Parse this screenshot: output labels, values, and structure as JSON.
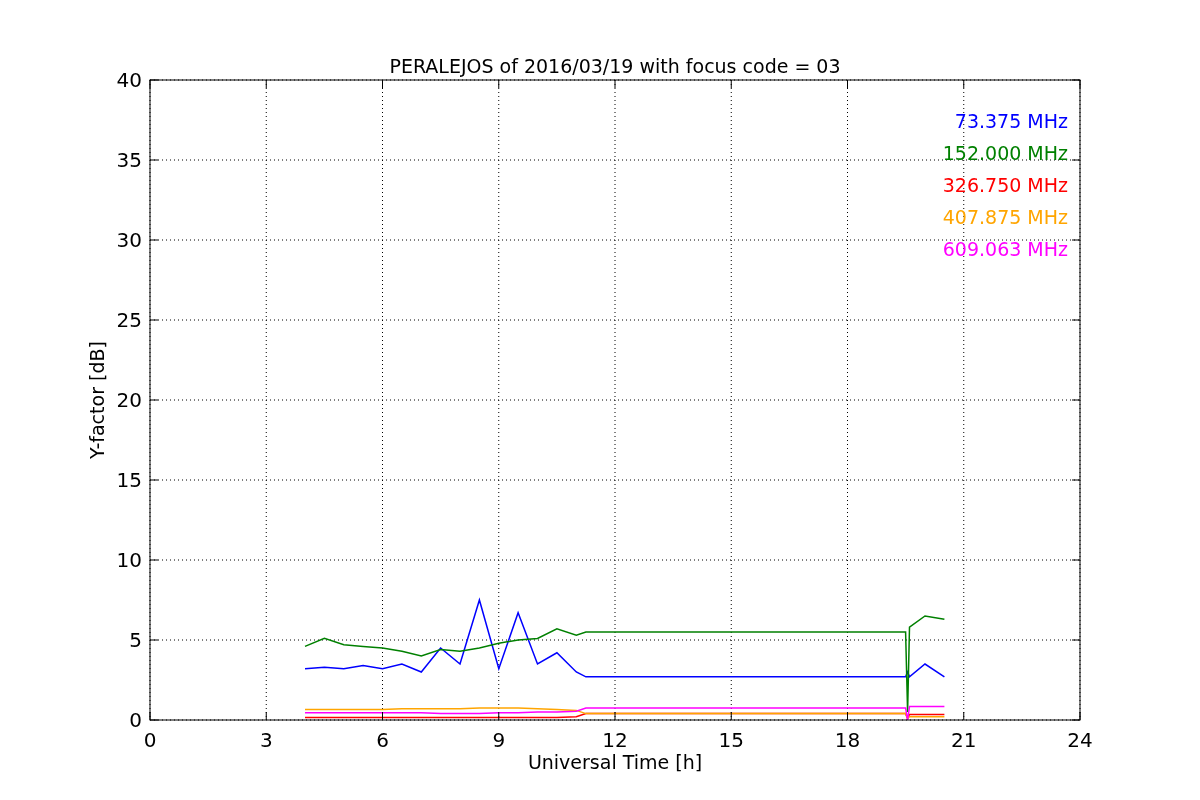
{
  "chart_data": {
    "type": "line",
    "title": "PERALEJOS of 2016/03/19 with focus code = 03",
    "xlabel": "Universal Time [h]",
    "ylabel": "Y-factor [dB]",
    "x": [
      4,
      4.5,
      5,
      5.5,
      6,
      6.5,
      7,
      7.5,
      8,
      8.5,
      9,
      9.5,
      10,
      10.5,
      11,
      11.25,
      19.5,
      19.55,
      19.6,
      20,
      20.5
    ],
    "series": [
      {
        "name": "73.375 MHz",
        "color": "#0000ff",
        "values": [
          3.2,
          3.3,
          3.2,
          3.4,
          3.2,
          3.5,
          3.0,
          4.5,
          3.5,
          7.5,
          3.2,
          6.7,
          3.5,
          4.2,
          3.0,
          2.7,
          2.7,
          3.0,
          2.7,
          3.5,
          2.7
        ]
      },
      {
        "name": "152.000 MHz",
        "color": "#008000",
        "values": [
          4.6,
          5.1,
          4.7,
          4.6,
          4.5,
          4.3,
          4.0,
          4.4,
          4.3,
          4.5,
          4.8,
          5.0,
          5.1,
          5.7,
          5.3,
          5.5,
          5.5,
          0.5,
          5.8,
          6.5,
          6.3
        ]
      },
      {
        "name": "326.750 MHz",
        "color": "#ff0000",
        "values": [
          0.15,
          0.15,
          0.15,
          0.15,
          0.15,
          0.15,
          0.15,
          0.15,
          0.15,
          0.15,
          0.15,
          0.15,
          0.15,
          0.15,
          0.2,
          0.4,
          0.4,
          0.1,
          0.35,
          0.35,
          0.35
        ]
      },
      {
        "name": "407.875 MHz",
        "color": "#ffa500",
        "values": [
          0.65,
          0.65,
          0.65,
          0.65,
          0.65,
          0.7,
          0.7,
          0.7,
          0.7,
          0.75,
          0.75,
          0.75,
          0.7,
          0.65,
          0.6,
          0.4,
          0.4,
          0.1,
          0.2,
          0.2,
          0.2
        ]
      },
      {
        "name": "609.063 MHz",
        "color": "#ff00ff",
        "values": [
          0.45,
          0.45,
          0.45,
          0.45,
          0.45,
          0.45,
          0.45,
          0.4,
          0.4,
          0.4,
          0.45,
          0.45,
          0.5,
          0.5,
          0.55,
          0.75,
          0.75,
          0.0,
          0.85,
          0.85,
          0.85
        ]
      }
    ],
    "grid": true,
    "xlim": [
      0,
      24
    ],
    "ylim": [
      0,
      40
    ],
    "xticks": [
      0,
      3,
      6,
      9,
      12,
      15,
      18,
      21,
      24
    ],
    "yticks": [
      0,
      5,
      10,
      15,
      20,
      25,
      30,
      35,
      40
    ]
  }
}
